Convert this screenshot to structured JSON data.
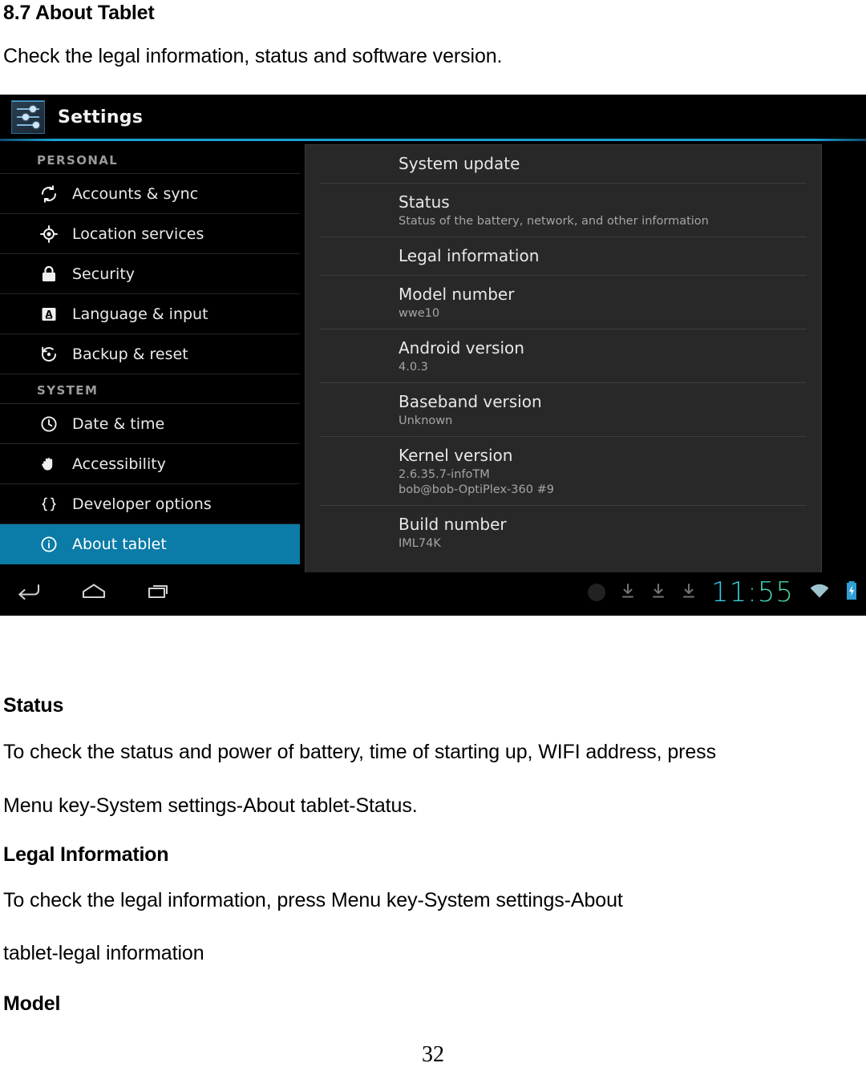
{
  "document": {
    "section_title": "8.7 About Tablet",
    "intro": "Check the legal information, status and software version.",
    "status_heading": "Status",
    "status_para_line1": "To check the status and power of battery, time of starting up, WIFI address, press",
    "status_para_line2": "Menu key-System settings-About tablet-Status.",
    "legal_heading": "Legal Information",
    "legal_para_line1": "To check the legal information, press Menu key-System settings-About",
    "legal_para_line2": "tablet-legal information",
    "model_heading": "Model",
    "page_number": "32"
  },
  "screenshot": {
    "action_bar": {
      "app_title": "Settings",
      "icon_name": "settings-sliders-icon"
    },
    "accent_color": "#0b7ba8",
    "sidebar": {
      "groups": [
        {
          "label": "PERSONAL",
          "items": [
            {
              "label": "Accounts & sync",
              "icon": "sync-icon",
              "selected": false
            },
            {
              "label": "Location services",
              "icon": "location-icon",
              "selected": false
            },
            {
              "label": "Security",
              "icon": "lock-icon",
              "selected": false
            },
            {
              "label": "Language & input",
              "icon": "keyboard-letter-icon",
              "selected": false
            },
            {
              "label": "Backup & reset",
              "icon": "backup-restore-icon",
              "selected": false
            }
          ]
        },
        {
          "label": "SYSTEM",
          "items": [
            {
              "label": "Date & time",
              "icon": "clock-icon",
              "selected": false
            },
            {
              "label": "Accessibility",
              "icon": "hand-icon",
              "selected": false
            },
            {
              "label": "Developer options",
              "icon": "braces-icon",
              "selected": false
            },
            {
              "label": "About tablet",
              "icon": "info-circle-icon",
              "selected": true
            }
          ]
        }
      ]
    },
    "detail": {
      "items": [
        {
          "title": "System update",
          "sub": ""
        },
        {
          "title": "Status",
          "sub": "Status of the battery, network, and other information"
        },
        {
          "title": "Legal information",
          "sub": ""
        },
        {
          "title": "Model number",
          "sub": "wwe10"
        },
        {
          "title": "Android version",
          "sub": "4.0.3"
        },
        {
          "title": "Baseband version",
          "sub": "Unknown"
        },
        {
          "title": "Kernel version",
          "sub": "2.6.35.7-infoTM\nbob@bob-OptiPlex-360 #9"
        },
        {
          "title": "Build number",
          "sub": "IML74K"
        }
      ]
    },
    "system_bar": {
      "nav": [
        {
          "icon": "back-icon"
        },
        {
          "icon": "home-icon"
        },
        {
          "icon": "recent-apps-icon"
        }
      ],
      "tray": [
        {
          "icon": "dim-circle-icon"
        },
        {
          "icon": "download-icon"
        },
        {
          "icon": "download-icon"
        },
        {
          "icon": "download-icon"
        }
      ],
      "clock": "11:55",
      "wifi_icon": "wifi-icon",
      "battery_icon": "battery-charging-icon"
    }
  }
}
